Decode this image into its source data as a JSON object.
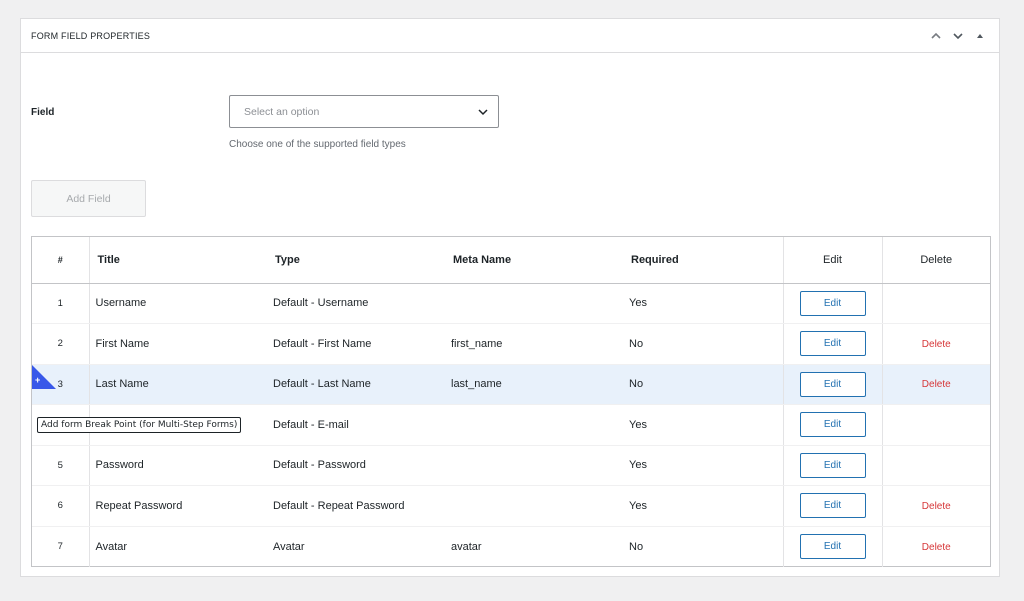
{
  "panel": {
    "title": "FORM FIELD PROPERTIES",
    "controls": [
      "chevron-up-icon",
      "chevron-down-icon",
      "triangle-up-icon"
    ]
  },
  "field": {
    "label": "Field",
    "select_placeholder": "Select an option",
    "help_text": "Choose one of the supported field types"
  },
  "add_field_label": "Add Field",
  "table": {
    "headers": {
      "num": "#",
      "title": "Title",
      "type": "Type",
      "meta": "Meta Name",
      "required": "Required",
      "edit": "Edit",
      "delete": "Delete"
    },
    "rows": [
      {
        "num": "1",
        "title": "Username",
        "type": "Default - Username",
        "meta": "",
        "required": "Yes",
        "edit": "Edit",
        "delete": ""
      },
      {
        "num": "2",
        "title": "First Name",
        "type": "Default - First Name",
        "meta": "first_name",
        "required": "No",
        "edit": "Edit",
        "delete": "Delete"
      },
      {
        "num": "3",
        "title": "Last Name",
        "type": "Default - Last Name",
        "meta": "last_name",
        "required": "No",
        "edit": "Edit",
        "delete": "Delete"
      },
      {
        "num": "",
        "title": "",
        "type": "Default - E-mail",
        "meta": "",
        "required": "Yes",
        "edit": "Edit",
        "delete": ""
      },
      {
        "num": "5",
        "title": "Password",
        "type": "Default - Password",
        "meta": "",
        "required": "Yes",
        "edit": "Edit",
        "delete": ""
      },
      {
        "num": "6",
        "title": "Repeat Password",
        "type": "Default - Repeat Password",
        "meta": "",
        "required": "Yes",
        "edit": "Edit",
        "delete": "Delete"
      },
      {
        "num": "7",
        "title": "Avatar",
        "type": "Avatar",
        "meta": "avatar",
        "required": "No",
        "edit": "Edit",
        "delete": "Delete"
      }
    ]
  },
  "breakpoint": {
    "plus": "+",
    "tooltip": "Add form Break Point (for Multi-Step Forms)"
  },
  "colors": {
    "accent": "#2271b1",
    "delete": "#d63638",
    "highlight_row": "#e8f1fb",
    "breakpoint": "#3858e9"
  }
}
